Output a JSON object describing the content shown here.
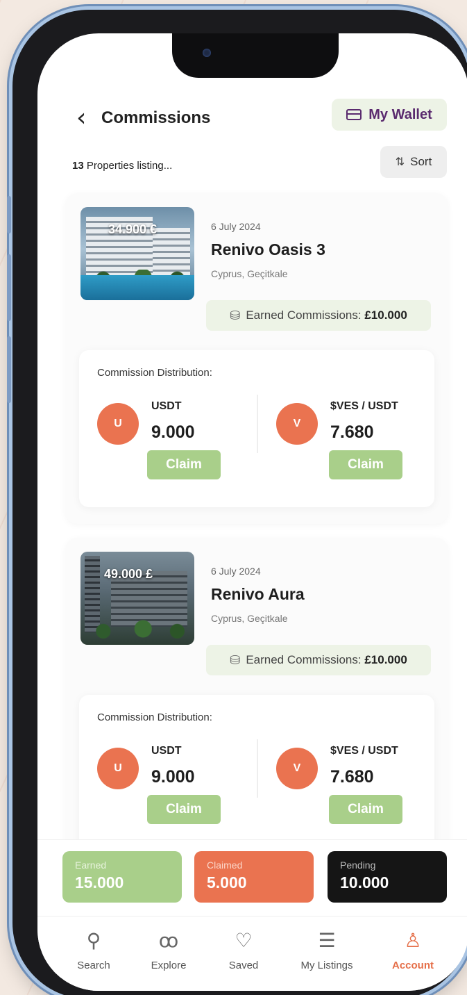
{
  "header": {
    "title": "Commissions",
    "wallet_label": "My Wallet"
  },
  "listing_summary": {
    "count": "13",
    "suffix": "Properties listing..."
  },
  "sort_label": "Sort",
  "cards": [
    {
      "price": "34.900 €",
      "date": "6 July 2024",
      "title": "Renivo Oasis 3",
      "location": "Cyprus, Geçitkale",
      "earned_label": "Earned Commissions:",
      "earned_value": "£10.000",
      "distribution_title": "Commission Distribution:",
      "coins": [
        {
          "initial": "U",
          "name": "USDT",
          "amount": "9.000",
          "claim": "Claim"
        },
        {
          "initial": "V",
          "name": "$VES / USDT",
          "amount": "7.680",
          "claim": "Claim"
        }
      ]
    },
    {
      "price": "49.000 £",
      "date": "6 July 2024",
      "title": "Renivo Aura",
      "location": "Cyprus, Geçitkale",
      "earned_label": "Earned Commissions:",
      "earned_value": "£10.000",
      "distribution_title": "Commission Distribution:",
      "coins": [
        {
          "initial": "U",
          "name": "USDT",
          "amount": "9.000",
          "claim": "Claim"
        },
        {
          "initial": "V",
          "name": "$VES / USDT",
          "amount": "7.680",
          "claim": "Claim"
        }
      ]
    }
  ],
  "summary": [
    {
      "label": "Earned",
      "value": "15.000",
      "color": "#a9cf8a"
    },
    {
      "label": "Claimed",
      "value": "5.000",
      "color": "#ea7350"
    },
    {
      "label": "Pending",
      "value": "10.000",
      "color": "#151515"
    }
  ],
  "nav": [
    {
      "label": "Search",
      "icon": "search-icon"
    },
    {
      "label": "Explore",
      "icon": "binoculars-icon"
    },
    {
      "label": "Saved",
      "icon": "heart-icon"
    },
    {
      "label": "My Listings",
      "icon": "checklist-icon"
    },
    {
      "label": "Account",
      "icon": "user-icon",
      "active": true
    }
  ],
  "colors": {
    "accent": "#e56f49",
    "claim_green": "#a9cf8a",
    "wallet_purple": "#5a2a6e"
  }
}
